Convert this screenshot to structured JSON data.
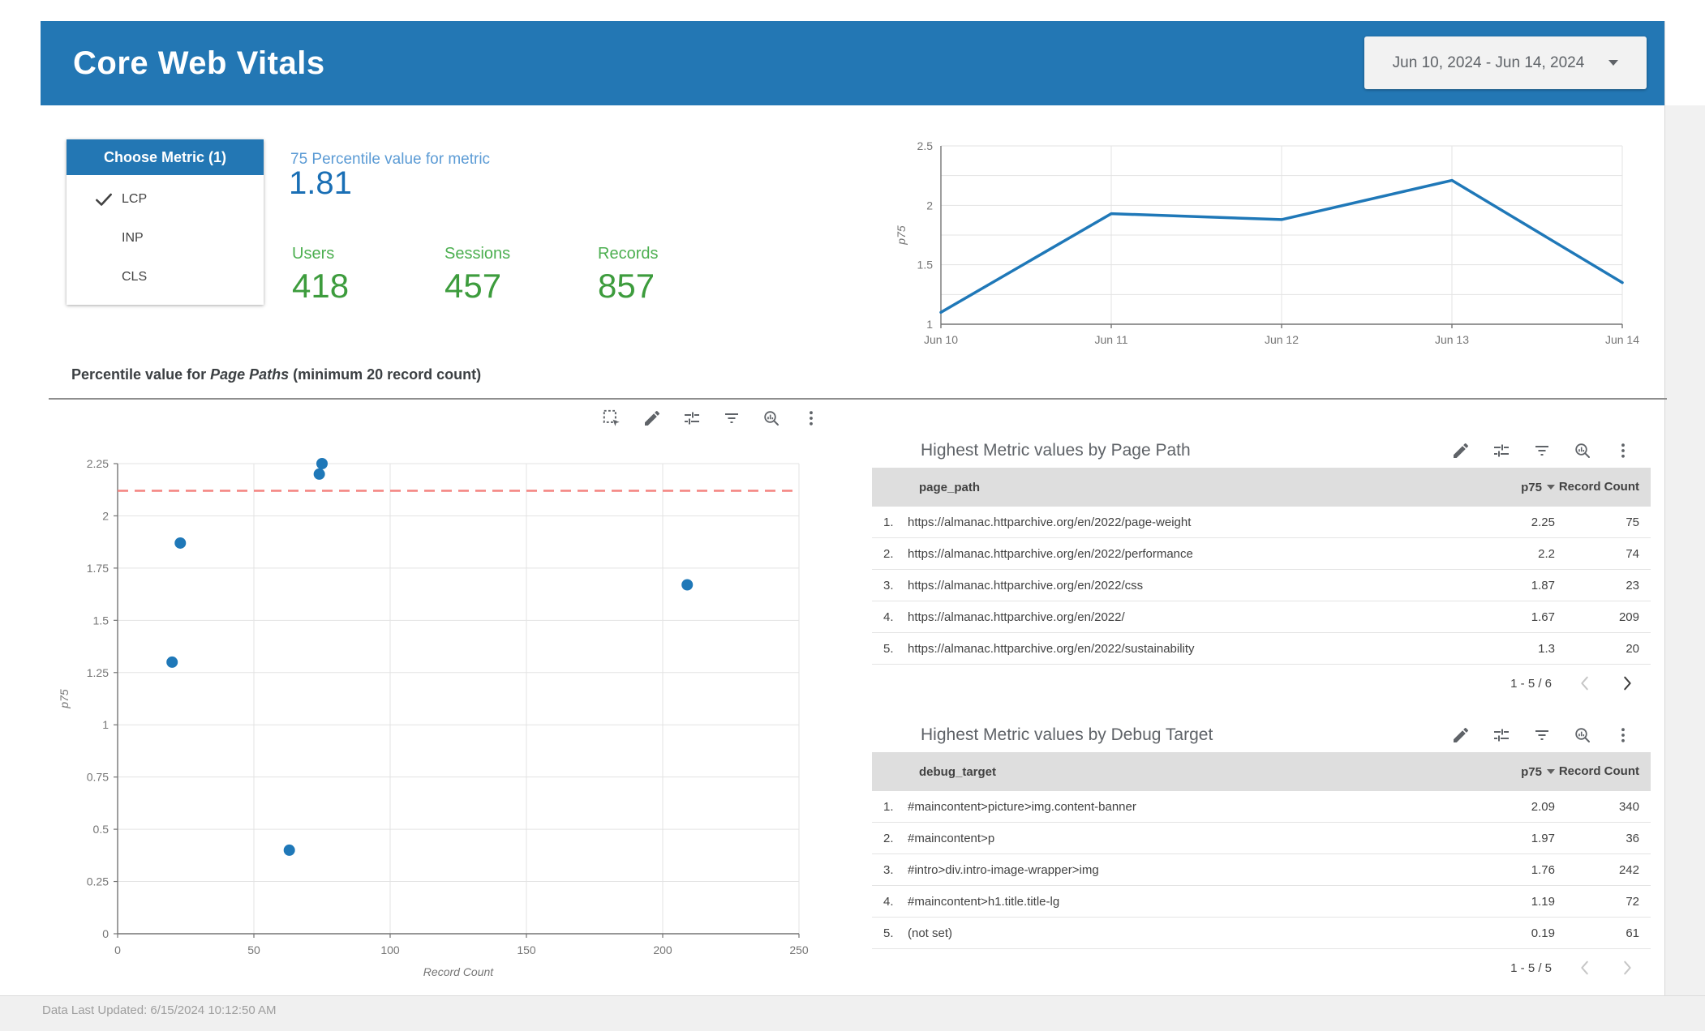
{
  "colors": {
    "header_blue": "#2377B4",
    "chart_blue": "#1F78B8",
    "reference_red": "#F4827F",
    "grid_gray": "#E3E3E3",
    "axis_gray": "#757575",
    "green_label": "#4CAF50",
    "green_value": "#3D9C3D",
    "blue_label": "#5B9BD5",
    "blue_value": "#1A6FB5"
  },
  "header": {
    "title": "Core Web Vitals",
    "date_range": "Jun 10, 2024 - Jun 14, 2024"
  },
  "metric_filter": {
    "title": "Choose Metric (1)",
    "options": [
      {
        "label": "LCP",
        "selected": true
      },
      {
        "label": "INP",
        "selected": false
      },
      {
        "label": "CLS",
        "selected": false
      }
    ]
  },
  "scorecards": {
    "primary": {
      "label": "75 Percentile value for metric",
      "value": "1.81"
    },
    "secondary": [
      {
        "label": "Users",
        "value": "418"
      },
      {
        "label": "Sessions",
        "value": "457"
      },
      {
        "label": "Records",
        "value": "857"
      }
    ]
  },
  "section_title": {
    "prefix": "Percentile value for ",
    "italic": "Page Paths",
    "suffix": " (minimum 20 record count)"
  },
  "chart_data": [
    {
      "type": "line",
      "title": "p75 by date",
      "x": [
        "Jun 10",
        "Jun 11",
        "Jun 12",
        "Jun 13",
        "Jun 14"
      ],
      "series": [
        {
          "name": "p75",
          "values": [
            1.1,
            1.93,
            1.88,
            2.21,
            1.35
          ]
        }
      ],
      "ylabel": "p75",
      "ylim": [
        1,
        2.5
      ],
      "yticks": [
        1,
        1.5,
        2,
        2.5
      ],
      "ygrid_step": 0.25,
      "grid": true,
      "legend": "none"
    },
    {
      "type": "scatter",
      "title": "Percentile value for Page Paths (minimum 20 record count)",
      "xlabel": "Record Count",
      "ylabel": "p75",
      "xlim": [
        0,
        250
      ],
      "ylim": [
        0,
        2.25
      ],
      "xticks": [
        0,
        50,
        100,
        150,
        200,
        250
      ],
      "yticks": [
        0,
        0.25,
        0.5,
        0.75,
        1,
        1.25,
        1.5,
        1.75,
        2,
        2.25
      ],
      "points": [
        {
          "x": 75,
          "y": 2.25
        },
        {
          "x": 74,
          "y": 2.2
        },
        {
          "x": 23,
          "y": 1.87
        },
        {
          "x": 209,
          "y": 1.67
        },
        {
          "x": 20,
          "y": 1.3
        },
        {
          "x": 63,
          "y": 0.4
        }
      ],
      "reference_line": {
        "y": 2.12,
        "style": "dashed"
      },
      "grid": true
    }
  ],
  "tables": [
    {
      "title": "Highest Metric values by Page Path",
      "columns": [
        "page_path",
        "p75",
        "Record Count"
      ],
      "rows": [
        {
          "index": "1.",
          "name": "https://almanac.httparchive.org/en/2022/page-weight",
          "p75": "2.25",
          "count": "75"
        },
        {
          "index": "2.",
          "name": "https://almanac.httparchive.org/en/2022/performance",
          "p75": "2.2",
          "count": "74"
        },
        {
          "index": "3.",
          "name": "https://almanac.httparchive.org/en/2022/css",
          "p75": "1.87",
          "count": "23"
        },
        {
          "index": "4.",
          "name": "https://almanac.httparchive.org/en/2022/",
          "p75": "1.67",
          "count": "209"
        },
        {
          "index": "5.",
          "name": "https://almanac.httparchive.org/en/2022/sustainability",
          "p75": "1.3",
          "count": "20"
        }
      ],
      "pagination": "1 - 5 / 6",
      "prev_enabled": false,
      "next_enabled": true
    },
    {
      "title": "Highest Metric values by Debug Target",
      "columns": [
        "debug_target",
        "p75",
        "Record Count"
      ],
      "rows": [
        {
          "index": "1.",
          "name": "#maincontent>picture>img.content-banner",
          "p75": "2.09",
          "count": "340"
        },
        {
          "index": "2.",
          "name": "#maincontent>p",
          "p75": "1.97",
          "count": "36"
        },
        {
          "index": "3.",
          "name": "#intro>div.intro-image-wrapper>img",
          "p75": "1.76",
          "count": "242"
        },
        {
          "index": "4.",
          "name": "#maincontent>h1.title.title-lg",
          "p75": "1.19",
          "count": "72"
        },
        {
          "index": "5.",
          "name": "(not set)",
          "p75": "0.19",
          "count": "61"
        }
      ],
      "pagination": "1 - 5 / 5",
      "prev_enabled": false,
      "next_enabled": false
    }
  ],
  "footer": {
    "text": "Data Last Updated: 6/15/2024 10:12:50 AM"
  }
}
